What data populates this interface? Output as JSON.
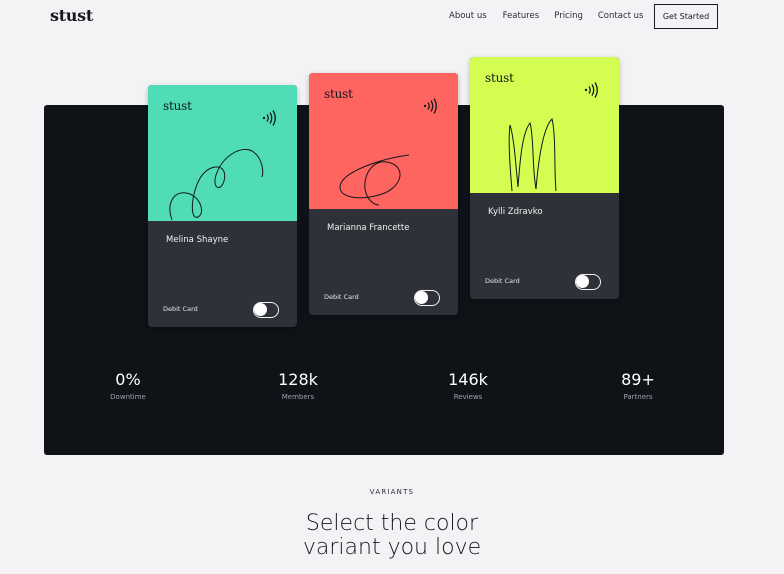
{
  "brand": {
    "logo": "stust"
  },
  "nav": {
    "items": [
      "About us",
      "Features",
      "Pricing",
      "Contact us"
    ],
    "cta": "Get Started"
  },
  "cards": [
    {
      "brand": "stust",
      "color": "#4fdcb6",
      "holder": "Melina Shayne",
      "type": "Debit Card"
    },
    {
      "brand": "stust",
      "color": "#fe6560",
      "holder": "Marianna Francette",
      "type": "Debit Card"
    },
    {
      "brand": "stust",
      "color": "#d4fd52",
      "holder": "Kylli Zdravko",
      "type": "Debit Card"
    }
  ],
  "stats": [
    {
      "value": "0%",
      "label": "Downtime"
    },
    {
      "value": "128k",
      "label": "Members"
    },
    {
      "value": "146k",
      "label": "Reviews"
    },
    {
      "value": "89+",
      "label": "Partners"
    }
  ],
  "variants": {
    "eyebrow": "VARIANTS",
    "headline_line1": "Select the color",
    "headline_line2": "variant you love"
  },
  "colors": {
    "background": "#f3f3f5",
    "panel": "#0f1217",
    "card_body": "#2e3138"
  }
}
